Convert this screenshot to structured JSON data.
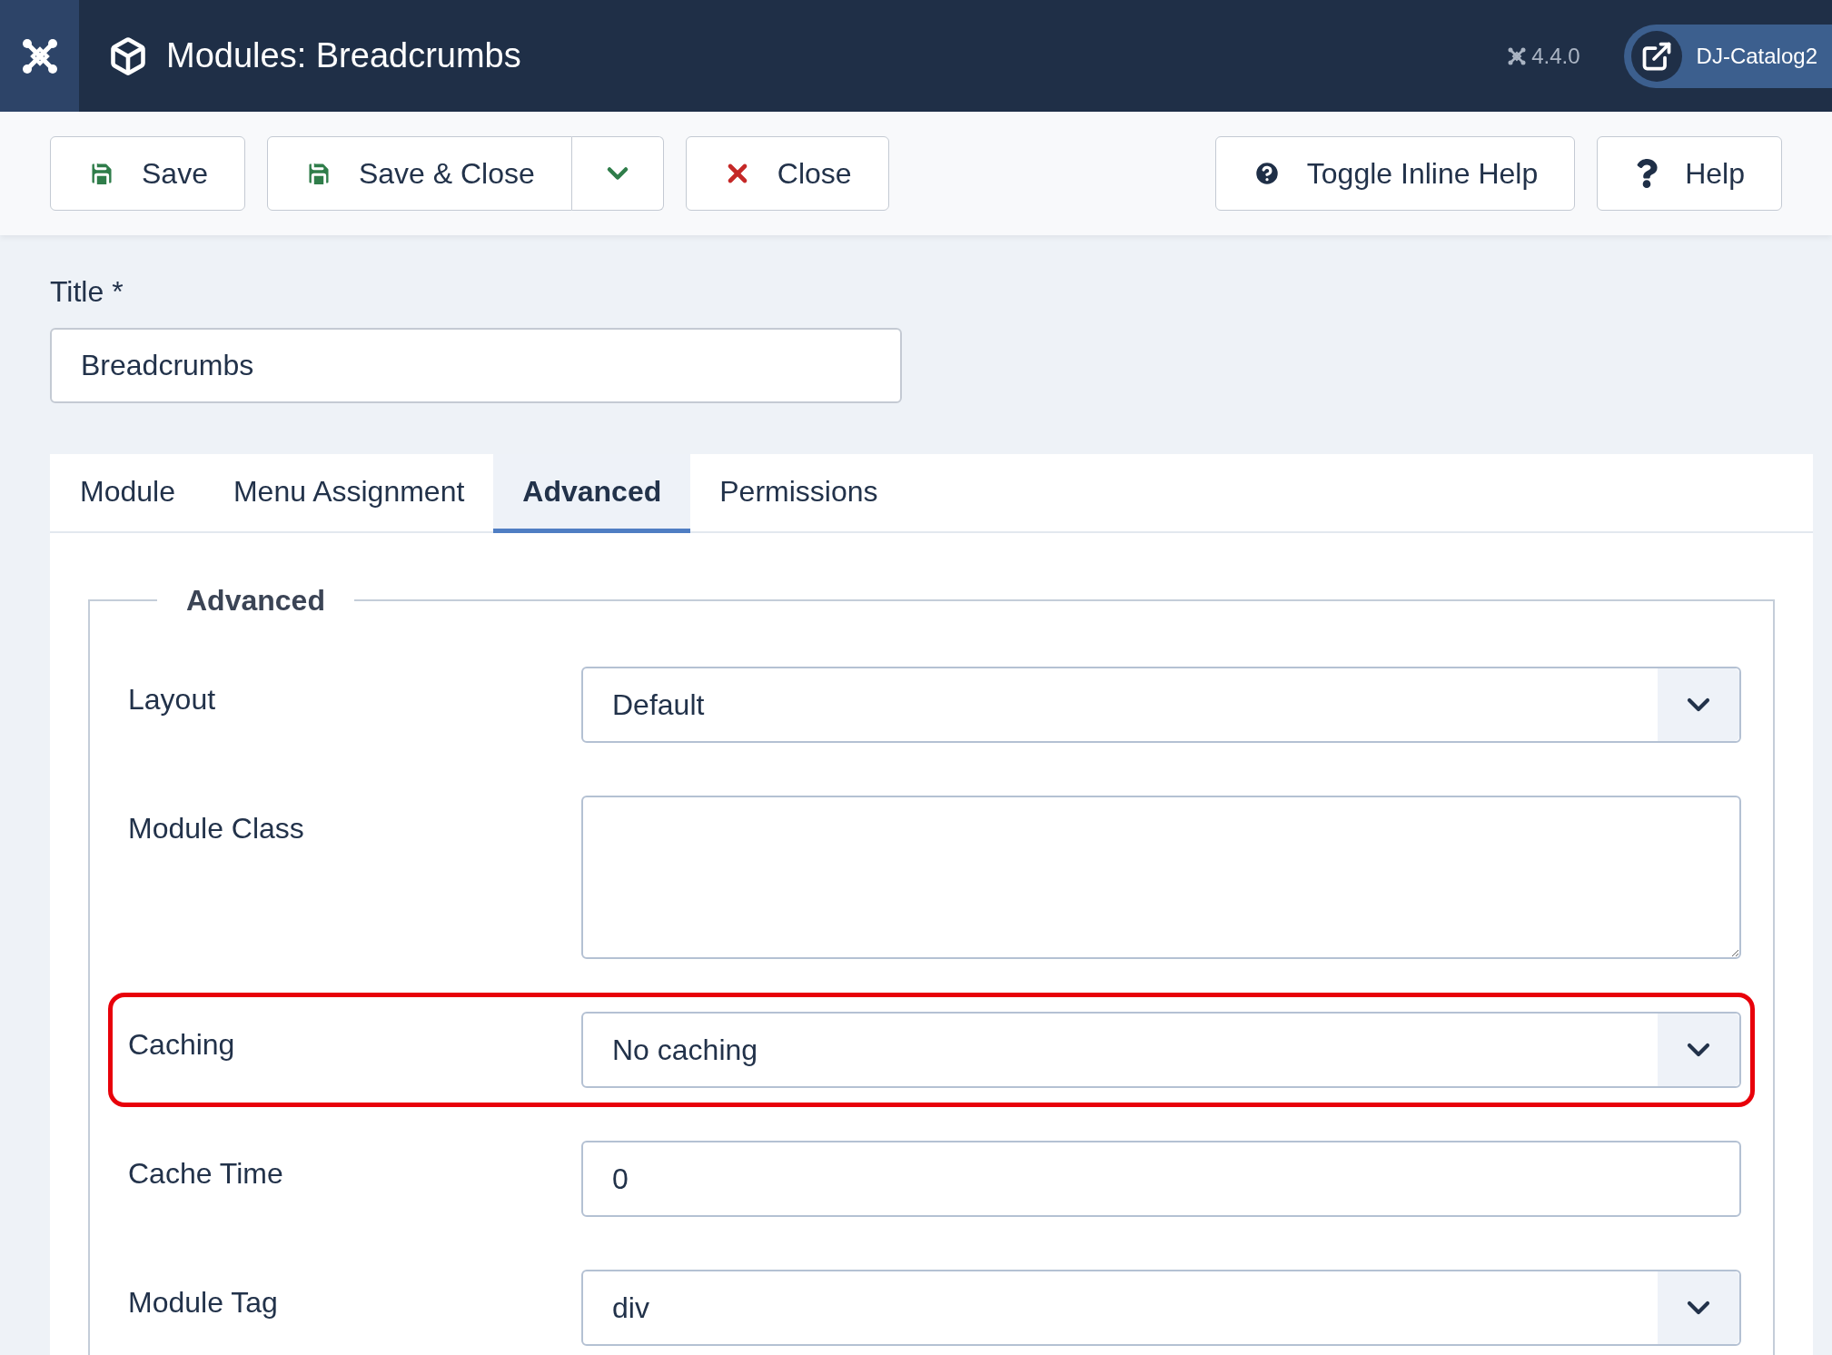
{
  "header": {
    "title": "Modules: Breadcrumbs",
    "version": "4.4.0",
    "site_link": "DJ-Catalog2"
  },
  "toolbar": {
    "left": [
      {
        "label": "Save",
        "kind": "save"
      },
      {
        "label": "Save & Close",
        "kind": "save-split"
      },
      {
        "label": "Close",
        "kind": "close"
      }
    ],
    "right": [
      {
        "label": "Toggle Inline Help",
        "kind": "toggle-help"
      },
      {
        "label": "Help",
        "kind": "help"
      }
    ]
  },
  "title_field": {
    "label": "Title *",
    "value": "Breadcrumbs"
  },
  "tabs": [
    {
      "label": "Module",
      "selected": false
    },
    {
      "label": "Menu Assignment",
      "selected": false
    },
    {
      "label": "Advanced",
      "selected": true
    },
    {
      "label": "Permissions",
      "selected": false
    }
  ],
  "fieldset": {
    "legend": "Advanced",
    "fields": [
      {
        "label": "Layout",
        "kind": "select",
        "value": "Default",
        "highlighted": false
      },
      {
        "label": "Module Class",
        "kind": "textarea",
        "highlighted": false
      },
      {
        "label": "Caching",
        "kind": "select",
        "value": "No caching",
        "highlighted": true
      },
      {
        "label": "Cache Time",
        "kind": "text",
        "value": "0",
        "highlighted": false
      },
      {
        "label": "Module Tag",
        "kind": "select",
        "value": "div",
        "highlighted": false
      }
    ]
  }
}
